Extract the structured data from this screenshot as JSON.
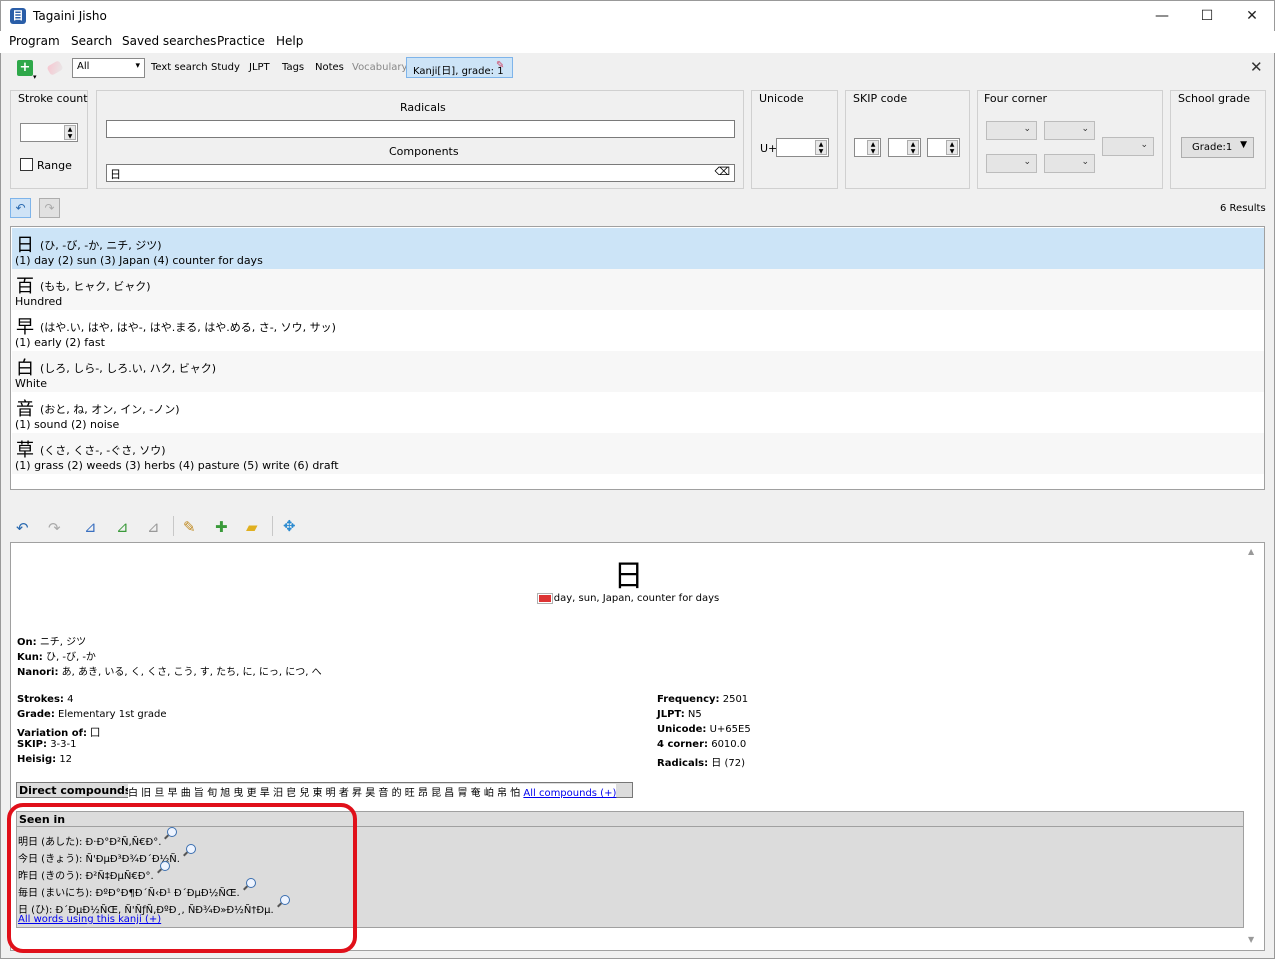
{
  "window": {
    "title": "Tagaini Jisho",
    "minimize": "—",
    "maximize": "☐",
    "close": "✕"
  },
  "menu": {
    "items": [
      "Program",
      "Search",
      "Saved searches",
      "Practice",
      "Help"
    ]
  },
  "toolbar": {
    "filter_value": "All",
    "tabs": [
      "Text search",
      "Study",
      "JLPT",
      "Tags",
      "Notes",
      "Vocabulary"
    ],
    "active_filter": "Kanji[日], grade: 1",
    "close": "✕"
  },
  "search": {
    "stroke_count_label": "Stroke count",
    "range_label": "Range",
    "radicals_label": "Radicals",
    "components_label": "Components",
    "components_value": "日",
    "unicode_label": "Unicode",
    "unicode_prefix": "U+",
    "skip_label": "SKIP code",
    "four_corner_label": "Four corner",
    "school_grade_label": "School grade",
    "school_grade_value": "Grade:1"
  },
  "results": {
    "count": "6 Results",
    "rows": [
      {
        "kanji": "日",
        "readings": "(ひ, -び, -か, ニチ, ジツ)",
        "meaning": "(1) day (2) sun (3) Japan (4) counter for days"
      },
      {
        "kanji": "百",
        "readings": "(もも, ヒャク, ビャク)",
        "meaning": "Hundred"
      },
      {
        "kanji": "早",
        "readings": "(はや.い, はや, はや-, はや.まる, はや.める, さ-, ソウ, サッ)",
        "meaning": "(1) early (2) fast"
      },
      {
        "kanji": "白",
        "readings": "(しろ, しら-, しろ.い, ハク, ビャク)",
        "meaning": "White"
      },
      {
        "kanji": "音",
        "readings": "(おと, ね, オン, イン, -ノン)",
        "meaning": "(1) sound (2) noise"
      },
      {
        "kanji": "草",
        "readings": "(くさ, くさ-, -ぐさ, ソウ)",
        "meaning": "(1) grass (2) weeds (3) herbs (4) pasture (5) write (6) draft"
      }
    ]
  },
  "detail": {
    "kanji": "日",
    "meanings": "day, sun, Japan, counter for days",
    "on_label": "On:",
    "on": "ニチ, ジツ",
    "kun_label": "Kun:",
    "kun": "ひ, -び, -か",
    "nanori_label": "Nanori:",
    "nanori": "あ, あき, いる, く, くさ, こう, す, たち, に, にっ, につ, へ",
    "strokes_label": "Strokes:",
    "strokes": "4",
    "grade_label": "Grade:",
    "grade": "Elementary 1st grade",
    "variation_label": "Variation of:",
    "variation": "囗",
    "skip_label": "SKIP:",
    "skip": "3-3-1",
    "heisig_label": "Heisig:",
    "heisig": "12",
    "frequency_label": "Frequency:",
    "frequency": "2501",
    "jlpt_label": "JLPT:",
    "jlpt": "N5",
    "unicode_label": "Unicode:",
    "unicode": "U+65E5",
    "corner_label": "4 corner:",
    "corner": "6010.0",
    "radicals_label": "Radicals:",
    "radicals": "日 (72)",
    "compounds_label": "Direct compounds:",
    "compounds": "白 旧 旦 早 曲 旨 旬 旭 曳 更 旱 汨 皀 兒 東 明 者 昇 昊 音 的 旺 昂 昆 昌 冐 奄 岶 帛 怕",
    "all_compounds": "All compounds (+)",
    "seen_in_label": "Seen in",
    "seen_in": [
      "明日 (あした): Ð·Ð°Ð²Ñ‚Ñ€Ð°.",
      "今日 (きょう): Ñ'ÐµÐ³Ð¾Ð´Ð½Ñ.",
      "昨日 (きのう): Ð²Ñ‡ÐµÑ€Ð°.",
      "毎日 (まいにち): ÐºÐ°Ð¶Ð´Ñ‹Ð¹ Ð´ÐµÐ½ÑŒ.",
      "日 (ひ): Ð´ÐµÐ½ÑŒ, Ñ'ÑƒÑ‚ÐºÐ¸, ÑÐ¾Ð»Ð½Ñ†Ðµ."
    ],
    "all_words": "All words using this kanji (+)"
  }
}
